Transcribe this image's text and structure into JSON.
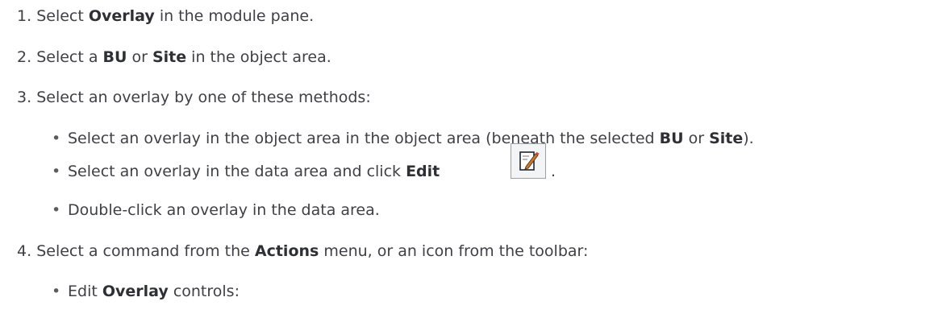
{
  "steps": [
    {
      "n": "1.",
      "pre": "Select ",
      "b1": "Overlay",
      "post": " in the module pane."
    },
    {
      "n": "2.",
      "pre": "Select a ",
      "b1": "BU",
      "mid": " or ",
      "b2": "Site",
      "post": " in the object area."
    },
    {
      "n": "3.",
      "text": "Select an overlay by one of these methods:"
    },
    {
      "n": "4.",
      "pre": "Select a command from the ",
      "b1": "Actions",
      "post": " menu, or an icon from the toolbar:"
    }
  ],
  "methods": [
    {
      "pre": "Select an overlay in the object area in the object area (beneath the selected ",
      "b1": "BU",
      "mid": " or ",
      "b2": "Site",
      "post": ")."
    },
    {
      "pre": "Select an overlay in the data area and click ",
      "b1": "Edit",
      "post": "."
    },
    {
      "text": "Double-click an overlay in the data area."
    }
  ],
  "sub": {
    "pre": "Edit ",
    "b1": "Overlay",
    "post": " controls:"
  },
  "bullet_char": "•",
  "icons": {
    "edit": "edit-icon"
  }
}
